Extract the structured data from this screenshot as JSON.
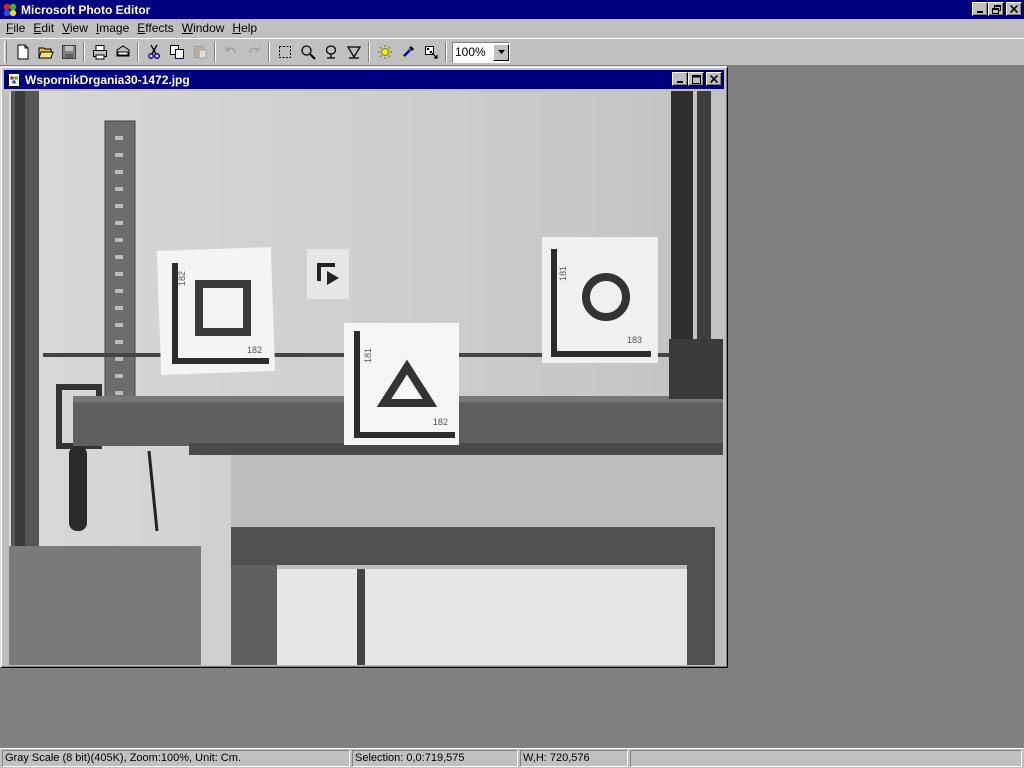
{
  "app": {
    "title": "Microsoft Photo Editor"
  },
  "menu": [
    "File",
    "Edit",
    "View",
    "Image",
    "Effects",
    "Window",
    "Help"
  ],
  "toolbar": {
    "buttons": [
      {
        "icon": "new-icon"
      },
      {
        "icon": "open-icon"
      },
      {
        "icon": "save-icon"
      },
      {
        "icon": "print-icon"
      },
      {
        "icon": "scan-icon"
      },
      {
        "icon": "cut-icon"
      },
      {
        "icon": "copy-icon"
      },
      {
        "icon": "paste-icon"
      },
      {
        "icon": "undo-icon"
      },
      {
        "icon": "redo-icon"
      },
      {
        "icon": "select-icon"
      },
      {
        "icon": "zoom-icon"
      },
      {
        "icon": "smudge-icon"
      },
      {
        "icon": "sharpen-icon"
      },
      {
        "icon": "balance-icon"
      },
      {
        "icon": "eyedropper-icon"
      },
      {
        "icon": "transparency-icon"
      }
    ],
    "zoom_value": "100%"
  },
  "document": {
    "title": "WspornikDrgania30-1472.jpg"
  },
  "image": {
    "labels": {
      "target_left": "182",
      "target_left_b": "182",
      "target_center": "181",
      "target_center_b": "182",
      "target_right": "181",
      "target_right_b": "183"
    }
  },
  "status": {
    "info": "Gray Scale (8 bit)(405K), Zoom:100%, Unit: Cm.",
    "selection": "Selection: 0,0:719,575",
    "size": "W,H: 720,576"
  },
  "colors": {
    "titlebar": "#000080",
    "face": "#c0c0c0",
    "workspace": "#808080"
  }
}
